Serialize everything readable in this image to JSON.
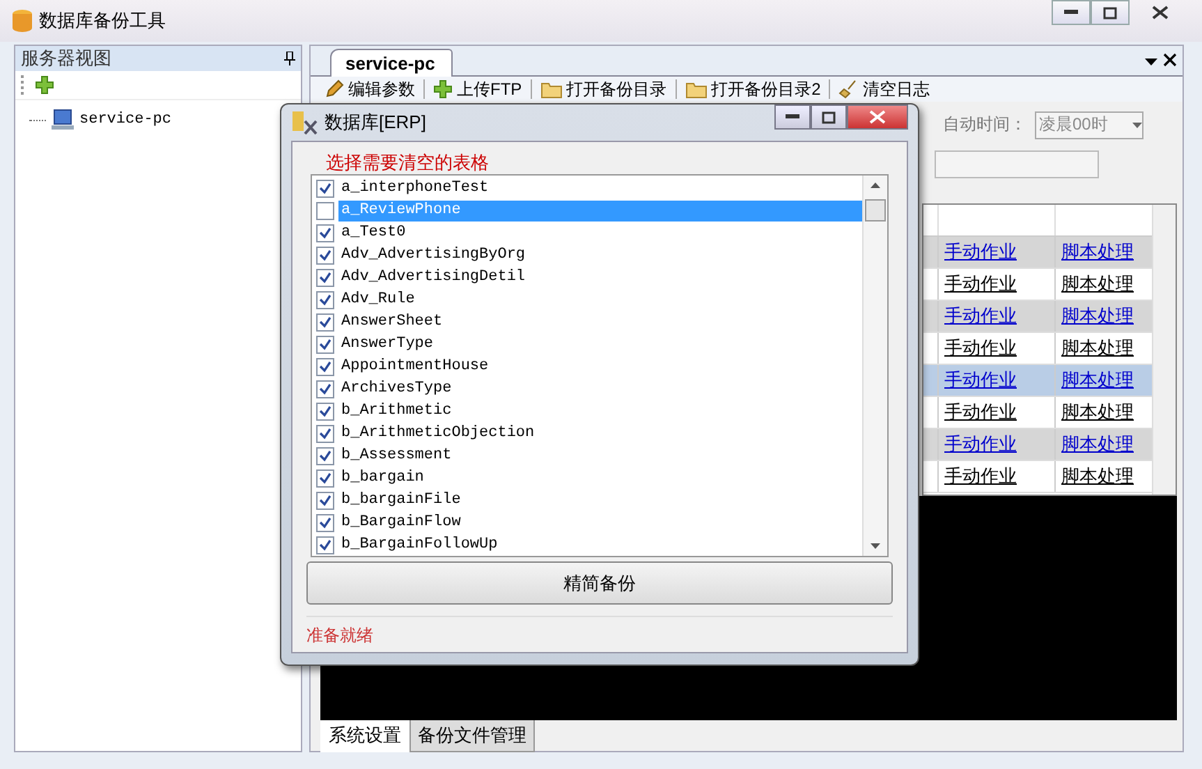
{
  "window": {
    "title": "数据库备份工具"
  },
  "server_panel": {
    "title": "服务器视图",
    "tree": [
      {
        "label": "service-pc"
      }
    ]
  },
  "document_tab": {
    "label": "service-pc"
  },
  "toolbar": [
    {
      "label": "编辑参数",
      "kind": "pencil"
    },
    {
      "label": "上传FTP",
      "kind": "plus"
    },
    {
      "label": "打开备份目录",
      "kind": "folder"
    },
    {
      "label": "打开备份目录2",
      "kind": "folder"
    },
    {
      "label": "清空日志",
      "kind": "broom"
    }
  ],
  "auto_time": {
    "label": "自动时间：",
    "value": "凌晨00时"
  },
  "grid": {
    "rows": [
      {
        "column_1": "手动作业",
        "column_2": "脚本处理",
        "selected": false
      },
      {
        "column_1": "手动作业",
        "column_2": "脚本处理",
        "selected": false
      },
      {
        "column_1": "手动作业",
        "column_2": "脚本处理",
        "selected": false
      },
      {
        "column_1": "手动作业",
        "column_2": "脚本处理",
        "selected": false
      },
      {
        "column_1": "手动作业",
        "column_2": "脚本处理",
        "selected": true
      },
      {
        "column_1": "手动作业",
        "column_2": "脚本处理",
        "selected": false
      },
      {
        "column_1": "手动作业",
        "column_2": "脚本处理",
        "selected": false
      },
      {
        "column_1": "手动作业",
        "column_2": "脚本处理",
        "selected": false
      }
    ]
  },
  "bottom_tabs": [
    {
      "label": "系统设置",
      "selected": true
    },
    {
      "label": "备份文件管理",
      "selected": false
    }
  ],
  "dialog": {
    "title": "数据库[ERP]",
    "group_label": "选择需要清空的表格",
    "tables": [
      {
        "name": "a_interphoneTest",
        "checked": true,
        "selected": false
      },
      {
        "name": "a_ReviewPhone",
        "checked": false,
        "selected": true
      },
      {
        "name": "a_Test0",
        "checked": true,
        "selected": false
      },
      {
        "name": "Adv_AdvertisingByOrg",
        "checked": true,
        "selected": false
      },
      {
        "name": "Adv_AdvertisingDetil",
        "checked": true,
        "selected": false
      },
      {
        "name": "Adv_Rule",
        "checked": true,
        "selected": false
      },
      {
        "name": "AnswerSheet",
        "checked": true,
        "selected": false
      },
      {
        "name": "AnswerType",
        "checked": true,
        "selected": false
      },
      {
        "name": "AppointmentHouse",
        "checked": true,
        "selected": false
      },
      {
        "name": "ArchivesType",
        "checked": true,
        "selected": false
      },
      {
        "name": "b_Arithmetic",
        "checked": true,
        "selected": false
      },
      {
        "name": "b_ArithmeticObjection",
        "checked": true,
        "selected": false
      },
      {
        "name": "b_Assessment",
        "checked": true,
        "selected": false
      },
      {
        "name": "b_bargain",
        "checked": true,
        "selected": false
      },
      {
        "name": "b_bargainFile",
        "checked": true,
        "selected": false
      },
      {
        "name": "b_BargainFlow",
        "checked": true,
        "selected": false
      },
      {
        "name": "b_BargainFollowUp",
        "checked": true,
        "selected": false
      }
    ],
    "button": "精简备份",
    "status": "准备就绪"
  }
}
